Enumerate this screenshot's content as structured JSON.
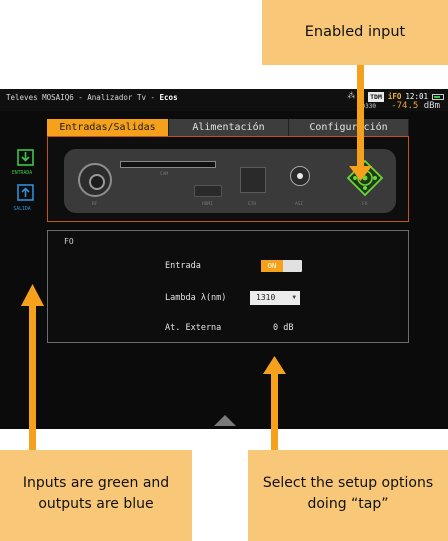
{
  "statusbar": {
    "app_title": "Televes MOSAIQ6 - Analizador Tv - ",
    "app_title_bold": "Ecos",
    "badge": "TDM",
    "fo": "iFO",
    "clock": "12:01",
    "small_readout": "0330",
    "level_value": "-74.5",
    "level_unit": "dBm"
  },
  "tabs": [
    {
      "label": "Entradas/Salidas",
      "active": true
    },
    {
      "label": "Alimentación",
      "active": false
    },
    {
      "label": "Configuración",
      "active": false
    }
  ],
  "sidebar": {
    "input_label": "ENTRADA",
    "output_label": "SALIDA"
  },
  "device": {
    "rf": "RF",
    "cam": "CAM",
    "hdmi": "HDMI",
    "eth": "ETH",
    "asi": "ASI",
    "fo": "FO"
  },
  "settings": {
    "section_title": "FO",
    "input_label": "Entrada",
    "input_state": "ON",
    "lambda_label": "Lambda λ(nm)",
    "lambda_value": "1310",
    "ext_att_label": "At. Externa",
    "ext_att_value": "0 dB"
  },
  "callouts": {
    "top": "Enabled input",
    "left": "Inputs are green and outputs are blue",
    "right": "Select the setup options doing “tap”"
  },
  "colors": {
    "accent": "#f5a11c",
    "input_green": "#3fc64a",
    "output_blue": "#2d8fd6",
    "callout_bg": "#f8c878",
    "arrow": "#f5a11c"
  }
}
